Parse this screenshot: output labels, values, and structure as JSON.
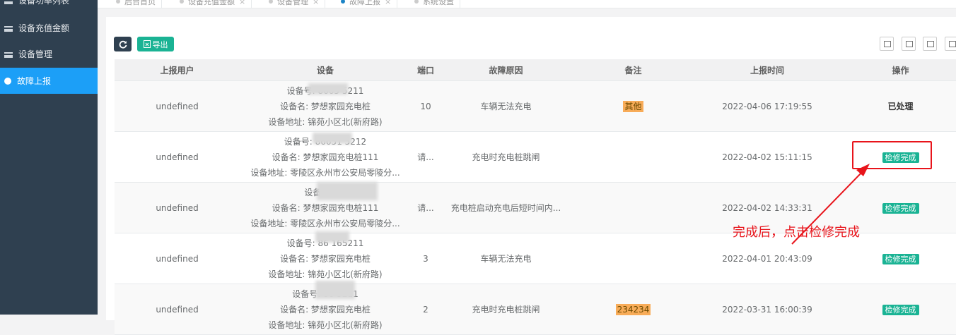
{
  "sidebar": {
    "items": [
      {
        "label": "设备功率列表",
        "icon": "list-icon",
        "active": false
      },
      {
        "label": "设备充值金额",
        "icon": "list-icon",
        "active": false
      },
      {
        "label": "设备管理",
        "icon": "list-icon",
        "active": false
      },
      {
        "label": "故障上报",
        "icon": "bug-icon",
        "active": true
      }
    ]
  },
  "tabs": [
    {
      "label": "后台首页",
      "active": false
    },
    {
      "label": "设备充值金额",
      "active": false
    },
    {
      "label": "设备管理",
      "active": false
    },
    {
      "label": "故障上报",
      "active": true
    },
    {
      "label": "系统设置",
      "active": false
    }
  ],
  "toolbar": {
    "refresh_icon": "refresh-icon",
    "export_label": "导出"
  },
  "table": {
    "headers": [
      "上报用户",
      "设备",
      "端口",
      "故障原因",
      "备注",
      "上报时间",
      "操作"
    ],
    "rows": [
      {
        "user": "undefined",
        "dev_no": "设备号: 8665          5211",
        "dev_name": "设备名: 梦想家园充电桩",
        "dev_addr": "设备地址: 锦苑小区北(新府路)",
        "port": "10",
        "reason": "车辆无法充电",
        "remark": "其他",
        "time": "2022-04-06 17:19:55",
        "action": "已处理",
        "action_type": "text"
      },
      {
        "user": "undefined",
        "dev_no": "设备号: 86651         5212",
        "dev_name": "设备名: 梦想家园充电桩111",
        "dev_addr": "设备地址: 零陵区永州市公安局零陵分...",
        "port": "请...",
        "reason": "充电时充电桩跳闸",
        "remark": "",
        "time": "2022-04-02 15:11:15",
        "action": "检修完成",
        "action_type": "button"
      },
      {
        "user": "undefined",
        "dev_no": "设备号: 86",
        "dev_name": "设备名: 梦想家园充电桩111",
        "dev_addr": "设备地址: 零陵区永州市公安局零陵分...",
        "port": "请...",
        "reason": "充电桩启动充电后短时间内...",
        "remark": "",
        "time": "2022-04-02 14:33:31",
        "action": "检修完成",
        "action_type": "button"
      },
      {
        "user": "undefined",
        "dev_no": "设备号: 86          165211",
        "dev_name": "设备名: 梦想家园充电桩",
        "dev_addr": "设备地址: 锦苑小区北(新府路)",
        "port": "3",
        "reason": "车辆无法充电",
        "remark": "",
        "time": "2022-04-01 20:43:09",
        "action": "检修完成",
        "action_type": "button"
      },
      {
        "user": "undefined",
        "dev_no": "设备号: 86          5211",
        "dev_name": "设备名: 梦想家园充电桩",
        "dev_addr": "设备地址: 锦苑小区北(新府路)",
        "port": "2",
        "reason": "充电时充电桩跳闸",
        "remark": "234234",
        "time": "2022-03-31 16:00:39",
        "action": "检修完成",
        "action_type": "button"
      }
    ]
  },
  "annotation": {
    "text": "完成后，点击检修完成",
    "color": "#e8141b"
  }
}
